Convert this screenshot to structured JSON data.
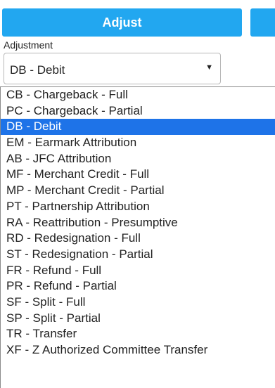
{
  "buttons": {
    "adjust_label": "Adjust",
    "second_label": "",
    "color": "#22a7f0"
  },
  "adjustment": {
    "label": "Adjustment",
    "selected_value": "DB - Debit",
    "arrow_icon": "triangle-down-icon",
    "options": [
      "CB - Chargeback - Full",
      "PC - Chargeback - Partial",
      "DB - Debit",
      "EM - Earmark Attribution",
      "AB - JFC Attribution",
      "MF - Merchant Credit - Full",
      "MP - Merchant Credit - Partial",
      "PT - Partnership Attribution",
      "RA - Reattribution - Presumptive",
      "RD - Redesignation - Full",
      "ST - Redesignation - Partial",
      "FR - Refund - Full",
      "PR - Refund - Partial",
      "SF - Split - Full",
      "SP - Split - Partial",
      "TR - Transfer",
      "XF - Z Authorized Committee Transfer"
    ],
    "highlighted_option": "DB - Debit",
    "highlight_color": "#1e73e8"
  }
}
